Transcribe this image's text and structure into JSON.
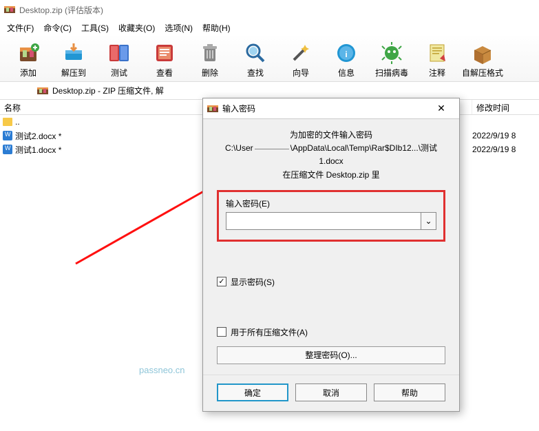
{
  "window": {
    "title": "Desktop.zip (评估版本)"
  },
  "menu": {
    "file": "文件(F)",
    "command": "命令(C)",
    "tools": "工具(S)",
    "fav": "收藏夹(O)",
    "options": "选项(N)",
    "help": "帮助(H)"
  },
  "toolbar": {
    "add": "添加",
    "extract": "解压到",
    "test": "测试",
    "view": "查看",
    "delete": "删除",
    "find": "查找",
    "wizard": "向导",
    "info": "信息",
    "scan": "扫描病毒",
    "comment": "注释",
    "sfx": "自解压格式"
  },
  "path": {
    "text": "Desktop.zip - ZIP 压缩文件, 解"
  },
  "columns": {
    "name": "名称",
    "time": "修改时间"
  },
  "files": {
    "up": "..",
    "f1": {
      "name": "测试2.docx *",
      "time": "2022/9/19 8"
    },
    "f2": {
      "name": "测试1.docx *",
      "time": "2022/9/19 8"
    }
  },
  "dialog": {
    "title": "输入密码",
    "hint1": "为加密的文件输入密码",
    "hint2": "C:\\User",
    "hint3": "\\AppData\\Local\\Temp\\Rar$DIb12...\\测试1.docx",
    "hint4": "在压缩文件 Desktop.zip 里",
    "field_label": "输入密码(E)",
    "show_pw": "显示密码(S)",
    "use_all": "用于所有压缩文件(A)",
    "organize": "整理密码(O)...",
    "ok": "确定",
    "cancel": "取消",
    "help": "帮助"
  },
  "watermark": "passneo.cn"
}
